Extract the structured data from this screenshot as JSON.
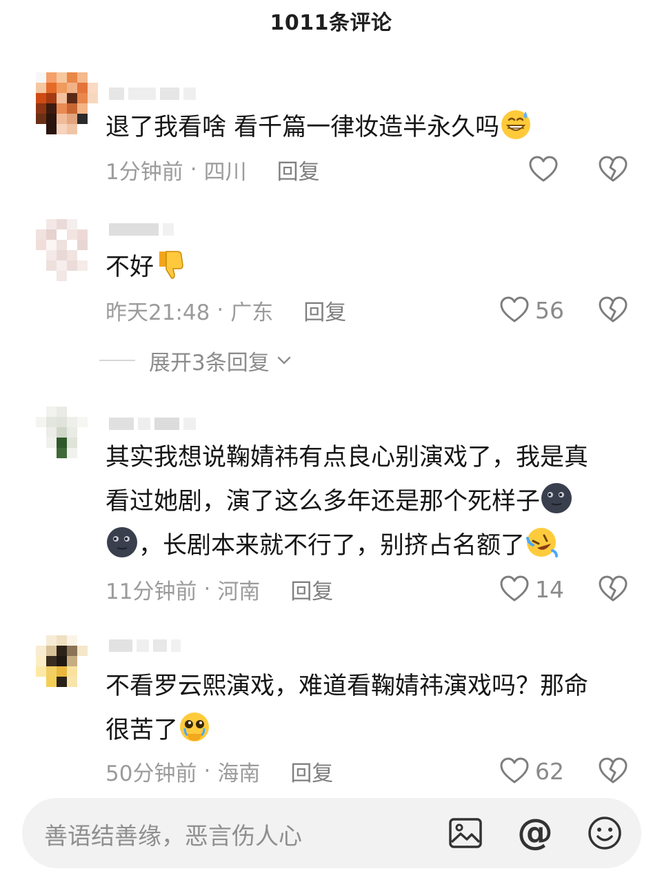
{
  "header": {
    "title": "1011条评论"
  },
  "comments": [
    {
      "text": "退了我看啥 看千篇一律妆造半永久吗",
      "time": "1分钟前",
      "location": "四川",
      "reply": "回复",
      "likes": "",
      "emoji": "grinning-sweat-emoji"
    },
    {
      "text": "不好",
      "time": "昨天21:48",
      "location": "广东",
      "reply": "回复",
      "likes": "56",
      "emoji": "thumbs-down-emoji"
    },
    {
      "text_line1": "其实我想说鞠婧祎有点良心别演戏了，我是真",
      "text_line2": "看过她剧，演了这么多年还是那个死样子",
      "text_line3": "，长剧本来就不行了，别挤占名额了",
      "time": "11分钟前",
      "location": "河南",
      "reply": "回复",
      "likes": "14",
      "emoji": "dark-moon-face-emoji"
    },
    {
      "text_line1": "不看罗云熙演戏，难道看鞠婧祎演戏吗？那命",
      "text_line2": "很苦了",
      "time": "50分钟前",
      "location": "海南",
      "reply": "回复",
      "likes": "62",
      "emoji": "pleading-tears-emoji"
    }
  ],
  "expand_replies": {
    "label": "展开3条回复"
  },
  "input": {
    "placeholder": "善语结善缘，恶言伤人心"
  },
  "icons": [
    "heart-icon",
    "heart-broken-icon",
    "image-icon",
    "at-icon",
    "smiley-icon",
    "chevron-down-icon"
  ],
  "colors": {
    "meta_gray": "#9b9b9b",
    "input_bg": "#f2f2f2",
    "text": "#161616"
  }
}
